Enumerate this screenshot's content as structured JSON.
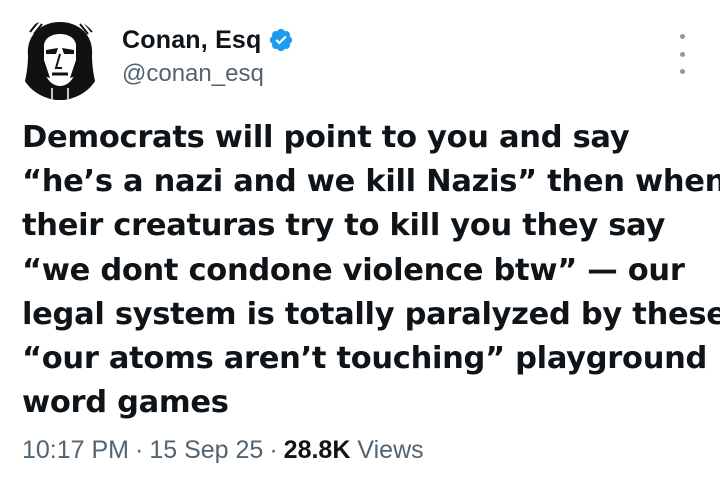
{
  "author": {
    "display_name": "Conan, Esq",
    "handle": "@conan_esq",
    "verified": true,
    "avatar_icon": "conan-portrait-avatar",
    "verified_icon": "verified-badge-icon",
    "verified_color": "#1d9bf0"
  },
  "menu": {
    "icon": "more-options-icon"
  },
  "tweet": {
    "lines": [
      "Democrats will point to you and say",
      "“he’s a nazi and we kill Nazis” then when",
      "their creaturas try to kill you they say",
      "“we dont condone violence btw” — our",
      "legal system is totally paralyzed by these",
      "“our atoms aren’t touching” playground",
      "word games"
    ]
  },
  "meta": {
    "time": "10:17 PM",
    "separator": "·",
    "date": "15 Sep 25",
    "views_count": "28.8K",
    "views_label": "Views"
  },
  "colors": {
    "text_primary": "#0f1419",
    "text_secondary": "#536471",
    "background": "#ffffff"
  }
}
